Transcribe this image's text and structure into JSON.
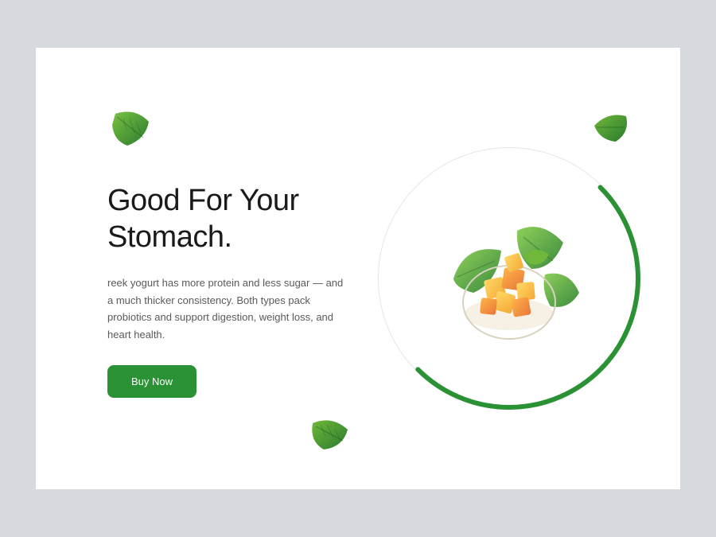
{
  "hero": {
    "heading": "Good For Your Stomach.",
    "description": "reek yogurt has more protein and less sugar — and a much thicker consistency. Both types pack probiotics and support digestion, weight loss, and heart health.",
    "cta_label": "Buy Now"
  },
  "colors": {
    "accent": "#2a9134"
  }
}
